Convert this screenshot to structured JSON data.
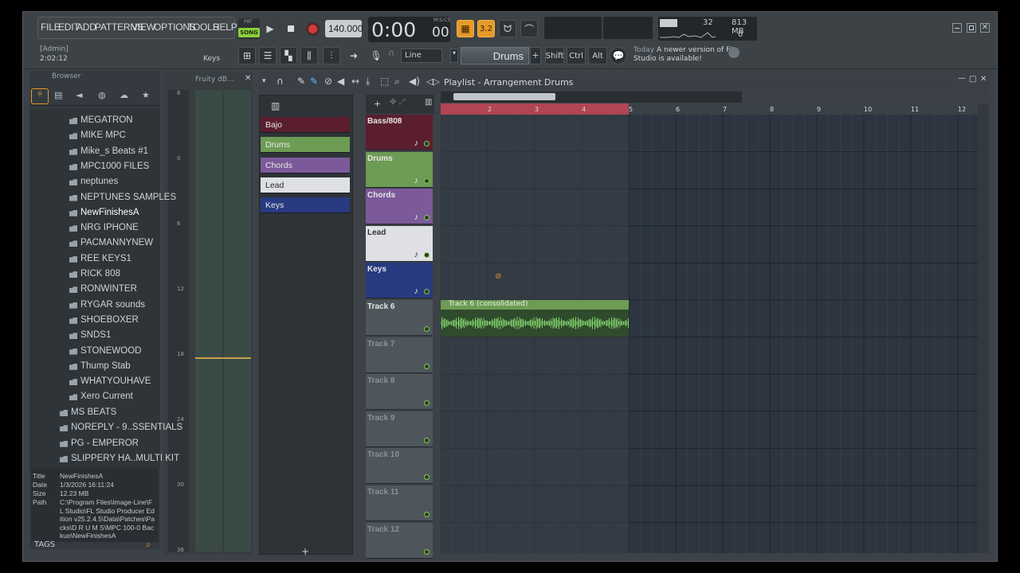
{
  "menu": [
    "FILE",
    "EDIT",
    "ADD",
    "PATTERNS",
    "VIEW",
    "OPTIONS",
    "TOOLS",
    "HELP"
  ],
  "transport": {
    "pat": "PAT",
    "song": "SONG",
    "tempo": "140.000",
    "time": "0:00",
    "time_ms": "00",
    "time_unit": "M:S:CS"
  },
  "monitor": {
    "cpu": "32",
    "ram": "813 MB",
    "voices": "0"
  },
  "hint": {
    "user": "[Admin]",
    "time": "2:02:12",
    "label": "Keys"
  },
  "toolbar2": {
    "snap": "Line",
    "pattern": "Drums",
    "shift": "Shift",
    "ctrl": "Ctrl",
    "alt": "Alt"
  },
  "news": {
    "when": "Today",
    "text": "A newer version of FL Studio is available!"
  },
  "browser": {
    "title": "Browser",
    "folders": [
      "MEGATRON",
      "MIKE MPC",
      "Mike_s Beats #1",
      "MPC1000 FILES",
      "neptunes",
      "NEPTUNES SAMPLES",
      "NewFinishesA",
      "NRG IPHONE",
      "PACMANNYNEW",
      "REE KEYS1",
      "RICK 808",
      "RONWINTER",
      "RYGAR sounds",
      "SHOEBOXER",
      "SNDS1",
      "STONEWOOD",
      "Thump Stab",
      "WHATYOUHAVE",
      "Xero Current"
    ],
    "subfolders": [
      "MS BEATS",
      "NOREPLY - 9..SSENTIALS",
      "PG - EMPEROR",
      "SLIPPERY HA..MULTI KIT"
    ],
    "selected": "NewFinishesA",
    "info": {
      "title_label": "Title",
      "title": "NewFinishesA",
      "date_label": "Date",
      "date": "1/3/2026 16:11:24",
      "size_label": "Size",
      "size": "12.23 MB",
      "path_label": "Path",
      "path": "C:\\Program Files\\Image-Line\\FL Studio\\FL Studio Producer Edition v25.2.4.5\\Data\\Patches\\Packs\\D R U M S\\MPC 100-0 Backup\\NewFinishesA"
    },
    "tags": "TAGS"
  },
  "mixer": {
    "title": "Fruity dB...",
    "ticks": [
      "6",
      "0",
      "6",
      "12",
      "18",
      "24",
      "30",
      "36"
    ]
  },
  "channels": [
    {
      "name": "Bajo",
      "color": "#5a1e2e"
    },
    {
      "name": "Drums",
      "color": "#6d9c55"
    },
    {
      "name": "Chords",
      "color": "#7c5a9a"
    },
    {
      "name": "Lead",
      "color": "#dfe0e6"
    },
    {
      "name": "Keys",
      "color": "#283a80"
    }
  ],
  "playlist": {
    "title": "Playlist - Arrangement",
    "pattern": "Drums",
    "ruler": [
      "2",
      "3",
      "4",
      "5",
      "6",
      "7",
      "8",
      "9",
      "10",
      "11",
      "12"
    ],
    "tracks": [
      {
        "name": "Bass/808",
        "color": "#5a1e2e"
      },
      {
        "name": "Drums",
        "color": "#6d9c55"
      },
      {
        "name": "Chords",
        "color": "#7c5a9a"
      },
      {
        "name": "Lead",
        "color": "#dfe0e6"
      },
      {
        "name": "Keys",
        "color": "#283a80"
      },
      {
        "name": "Track 6",
        "color": "#4e565c"
      },
      {
        "name": "Track 7",
        "color": "#4e565c"
      },
      {
        "name": "Track 8",
        "color": "#4e565c"
      },
      {
        "name": "Track 9",
        "color": "#4e565c"
      },
      {
        "name": "Track 10",
        "color": "#4e565c"
      },
      {
        "name": "Track 11",
        "color": "#4e565c"
      },
      {
        "name": "Track 12",
        "color": "#4e565c"
      }
    ],
    "clip": "Track 6 (consolidated)"
  }
}
